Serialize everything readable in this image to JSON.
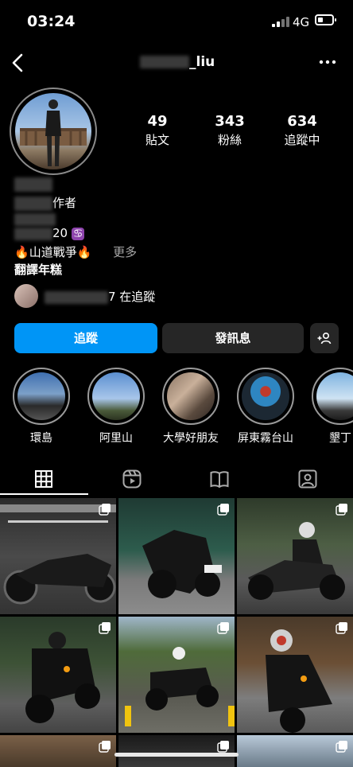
{
  "status_bar": {
    "time": "03:24",
    "network": "4G"
  },
  "header": {
    "username_suffix": "_liu"
  },
  "profile": {
    "stats": [
      {
        "value": "49",
        "label": "貼文"
      },
      {
        "value": "343",
        "label": "粉絲"
      },
      {
        "value": "634",
        "label": "追蹤中"
      }
    ],
    "bio": {
      "line2_suffix": "作者",
      "line4_suffix": "20",
      "zodiac_glyph": "♋",
      "tag_line": "山道戰爭",
      "fire_glyph": "🔥",
      "more_label": "更多",
      "line5": "翻譯年糕"
    },
    "followed_by": {
      "suffix": "7 在追蹤"
    }
  },
  "actions": {
    "follow": "追蹤",
    "message": "發訊息"
  },
  "highlights": [
    {
      "label": "環島"
    },
    {
      "label": "阿里山"
    },
    {
      "label": "大學好朋友"
    },
    {
      "label": "屏東霧台山"
    },
    {
      "label": "墾丁"
    }
  ],
  "icons": {
    "back": "chevron-left-icon",
    "more": "ellipsis-icon",
    "add_person": "add-person-icon",
    "tabs": [
      "grid-icon",
      "reels-icon",
      "guide-icon",
      "tagged-icon"
    ]
  }
}
